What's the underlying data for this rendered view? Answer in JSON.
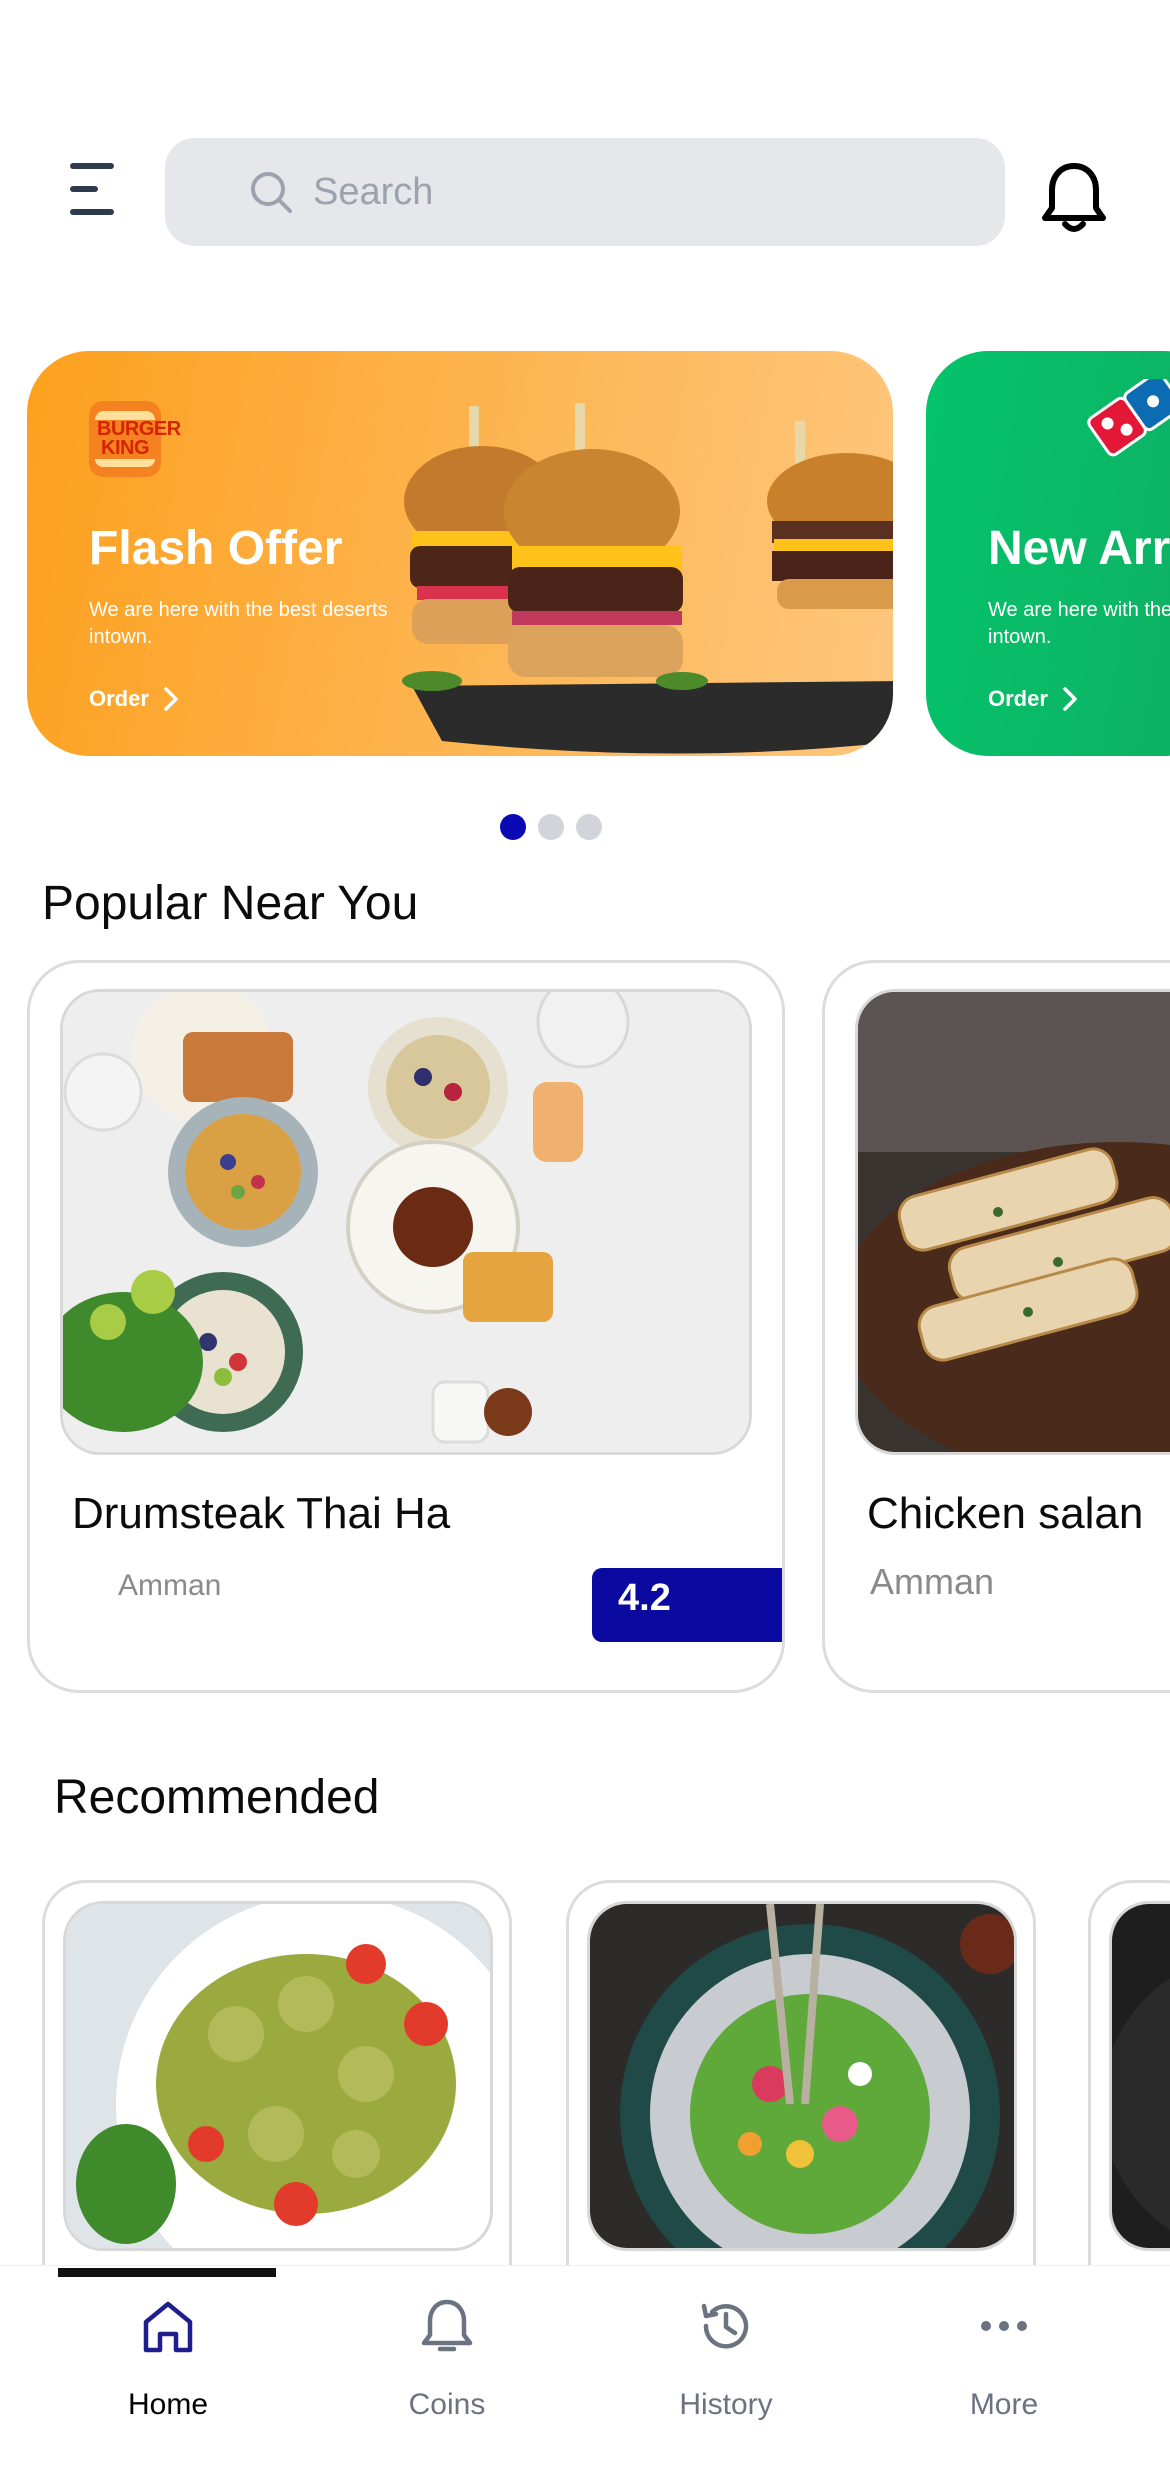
{
  "header": {
    "search_placeholder": "Search",
    "menu_icon": "hamburger-menu-icon",
    "notification_icon": "bell-icon"
  },
  "banners": [
    {
      "brand_logo_text": "BURGER KING",
      "title": "Flash Offer",
      "description": "We are here with the best deserts intown.",
      "cta": "Order",
      "color": "#FDA01E"
    },
    {
      "brand_logo_text": "Domino's Pizza",
      "title": "New Arrival",
      "description": "We are here with the best deserts intown.",
      "cta": "Order",
      "color": "#04C46B"
    }
  ],
  "carousel": {
    "page_count": 3,
    "active_index": 0,
    "active_color": "#0A0AB4"
  },
  "popular": {
    "title": "Popular Near You",
    "items": [
      {
        "name": "Drumsteak Thai Ha",
        "location": "Amman",
        "rating": "4.2"
      },
      {
        "name": "Chicken salan",
        "location": "Amman"
      }
    ]
  },
  "recommended": {
    "title": "Recommended"
  },
  "bottom_nav": {
    "items": [
      {
        "label": "Home",
        "icon": "home-icon",
        "active": true
      },
      {
        "label": "Coins",
        "icon": "bell-icon"
      },
      {
        "label": "History",
        "icon": "history-icon"
      },
      {
        "label": "More",
        "icon": "more-dots-icon"
      }
    ]
  },
  "colors": {
    "accent": "#0A0AA0",
    "nav_active": "#1E1E8C"
  }
}
